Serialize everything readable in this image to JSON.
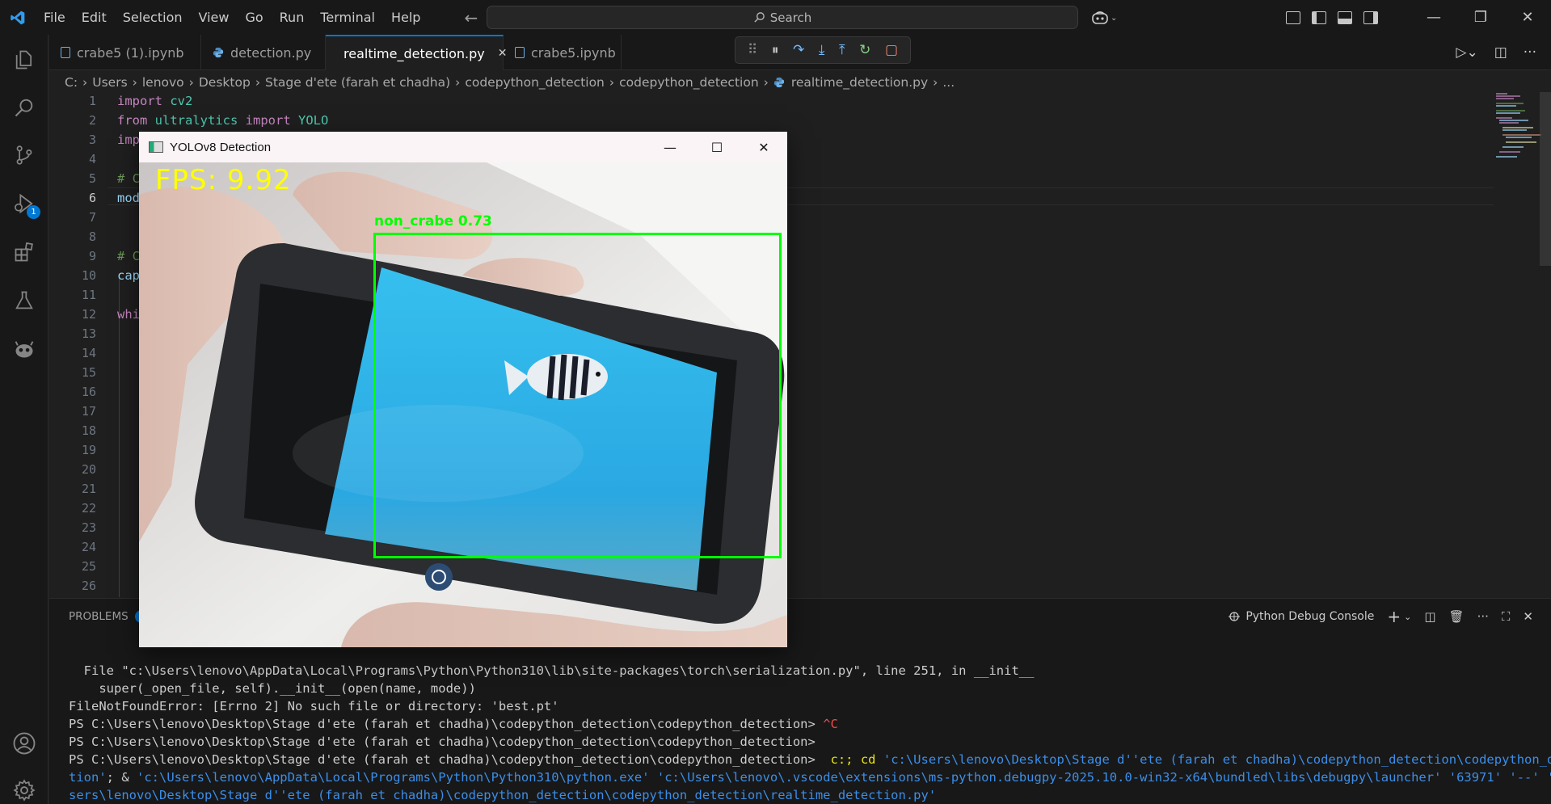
{
  "window": {
    "menu": [
      "File",
      "Edit",
      "Selection",
      "View",
      "Go",
      "Run",
      "Terminal",
      "Help"
    ],
    "search_placeholder": "Search"
  },
  "activity": {
    "debug_badge": "1"
  },
  "tabs": [
    {
      "label": "crabe5 (1).ipynb",
      "type": "notebook",
      "active": false
    },
    {
      "label": "detection.py",
      "type": "python",
      "active": false
    },
    {
      "label": "realtime_detection.py",
      "type": "python",
      "active": true
    },
    {
      "label": "crabe5.ipynb",
      "type": "notebook",
      "active": false
    }
  ],
  "breadcrumb": [
    "C:",
    "Users",
    "lenovo",
    "Desktop",
    "Stage d'ete (farah et chadha)",
    "codepython_detection",
    "codepython_detection",
    "realtime_detection.py",
    "..."
  ],
  "editor": {
    "line_numbers": [
      "1",
      "2",
      "3",
      "4",
      "5",
      "6",
      "7",
      "8",
      "9",
      "10",
      "11",
      "12",
      "13",
      "14",
      "15",
      "16",
      "17",
      "18",
      "19",
      "20",
      "21",
      "22",
      "23",
      "24",
      "25",
      "26"
    ],
    "active_line": "6",
    "code": {
      "l1_kw": "import",
      "l1_mod": " cv2",
      "l2_kw": "from",
      "l2_a": " ultralytics ",
      "l2_kw2": "import",
      "l2_mod": " YOLO",
      "l3_kw": "imp",
      "l5_cmt": "# C",
      "l6_var": "mod",
      "l8_cmt": "# C",
      "l9_var": "cap",
      "l11_kw": "whi"
    }
  },
  "panel": {
    "tab_label": "PROBLEMS",
    "problems_count": "6",
    "console_label": "Python Debug Console",
    "terminal_lines": [
      "  File \"c:\\Users\\lenovo\\AppData\\Local\\Programs\\Python\\Python310\\lib\\site-packages\\torch\\serialization.py\", line 251, in __init__",
      "    super(_open_file, self).__init__(open(name, mode))",
      "FileNotFoundError: [Errno 2] No such file or directory: 'best.pt'"
    ],
    "prompt": "PS C:\\Users\\lenovo\\Desktop\\Stage d'ete (farah et chadha)\\codepython_detection\\codepython_detection>",
    "ctrl_c": " ^C",
    "cmd_yellow": "  c:; cd ",
    "cmd_cyan_1": "'c:\\Users\\lenovo\\Desktop\\Stage d''ete (farah et chadha)\\codepython_detection\\codepython_detec",
    "cmd_line2_a": "tion'",
    "cmd_line2_b": "; & ",
    "cmd_line2_c": "'c:\\Users\\lenovo\\AppData\\Local\\Programs\\Python\\Python310\\python.exe' 'c:\\Users\\lenovo\\.vscode\\extensions\\ms-python.debugpy-2025.10.0-win32-x64\\bundled\\libs\\debugpy\\launcher' '63971' '--' 'c:\\U",
    "cmd_line3": "sers\\lenovo\\Desktop\\Stage d''ete (farah et chadha)\\codepython_detection\\codepython_detection\\realtime_detection.py'"
  },
  "cv_window": {
    "title": "YOLOv8 Detection",
    "fps_text": "FPS: 9.92",
    "detection_label": "non_crabe 0.73",
    "box_color": "#00ff00",
    "fps_color": "#ffff00"
  }
}
